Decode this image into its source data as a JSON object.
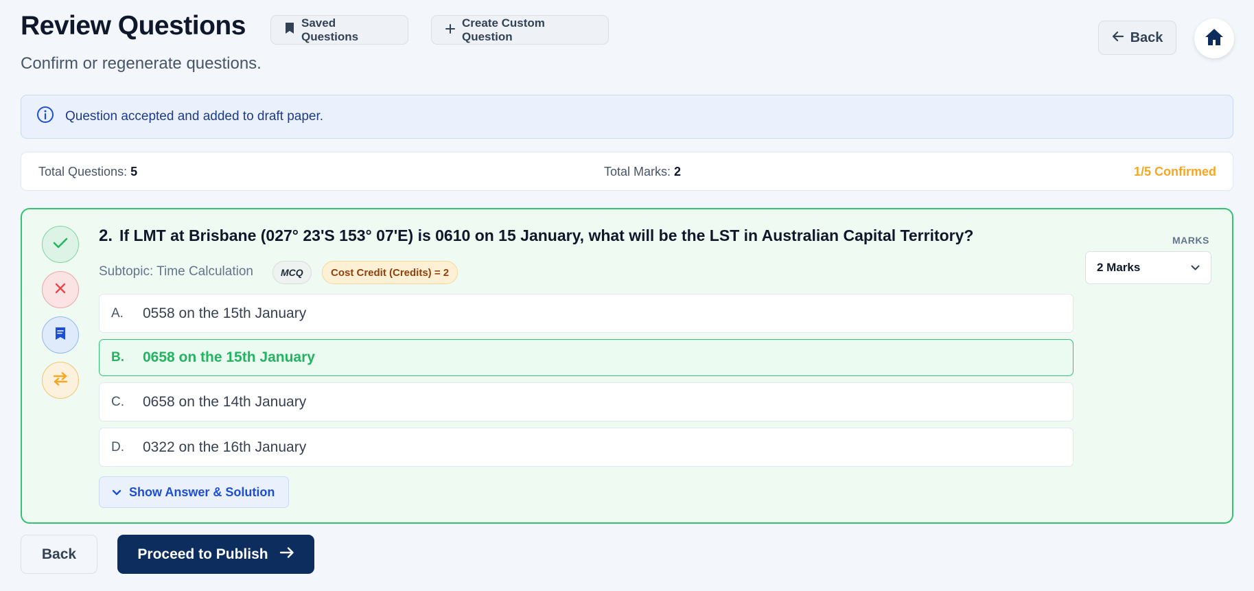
{
  "header": {
    "title": "Review Questions",
    "subtitle": "Confirm or regenerate questions.",
    "saved_label": "Saved Questions",
    "create_label": "Create Custom Question",
    "back_label": "Back"
  },
  "alert": {
    "message": "Question accepted and added to draft paper."
  },
  "stats": {
    "total_questions_label": "Total Questions:",
    "total_questions_value": "5",
    "total_marks_label": "Total Marks:",
    "total_marks_value": "2",
    "confirmed": "1/5 Confirmed"
  },
  "question": {
    "number": "2.",
    "text": "If LMT at Brisbane (027° 23'S 153° 07'E) is 0610 on 15 January, what will be the LST in Australian Capital Territory?",
    "subtopic": "Subtopic: Time Calculation",
    "type_badge": "MCQ",
    "credit_badge": "Cost Credit (Credits) = 2",
    "options": [
      {
        "letter": "A.",
        "text": "0558 on the 15th January"
      },
      {
        "letter": "B.",
        "text": "0658 on the 15th January"
      },
      {
        "letter": "C.",
        "text": "0658 on the 14th January"
      },
      {
        "letter": "D.",
        "text": "0322 on the 16th January"
      }
    ],
    "show_answer_label": "Show Answer & Solution",
    "marks_label": "MARKS",
    "marks_value": "2 Marks"
  },
  "footer": {
    "back_label": "Back",
    "publish_label": "Proceed to Publish"
  },
  "colors": {
    "primary": "#0c2d5e",
    "success": "#34c173",
    "warning": "#f5a623",
    "danger": "#e5484d",
    "info": "#1d4ed8"
  }
}
